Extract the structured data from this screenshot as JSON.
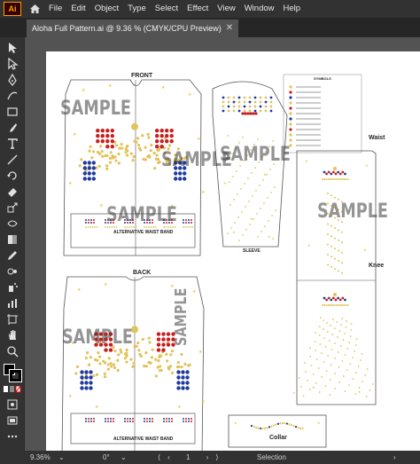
{
  "menubar": {
    "items": [
      "File",
      "Edit",
      "Object",
      "Type",
      "Select",
      "Effect",
      "View",
      "Window",
      "Help"
    ]
  },
  "document": {
    "tab_title": "Aloha Full Pattern.ai @ 9.36 % (CMYK/CPU Preview)"
  },
  "artboard": {
    "front_label": "FRONT",
    "back_label": "BACK",
    "sleeve_label": "SLEEVE",
    "waist_label": "Waist",
    "knee_label": "Knee",
    "collar_label": "Collar",
    "alt_waistband_label": "ALTERNATIVE WAIST BAND",
    "watermark": "SAMPLE",
    "legend_title": "SYMBOLS"
  },
  "status": {
    "zoom": "9.36%",
    "rotation": "0°",
    "mode": "Selection"
  },
  "colors": {
    "red": "#c81e1e",
    "blue": "#1f3a9e",
    "gold": "#e2c25a",
    "star": "#e8c94a"
  }
}
